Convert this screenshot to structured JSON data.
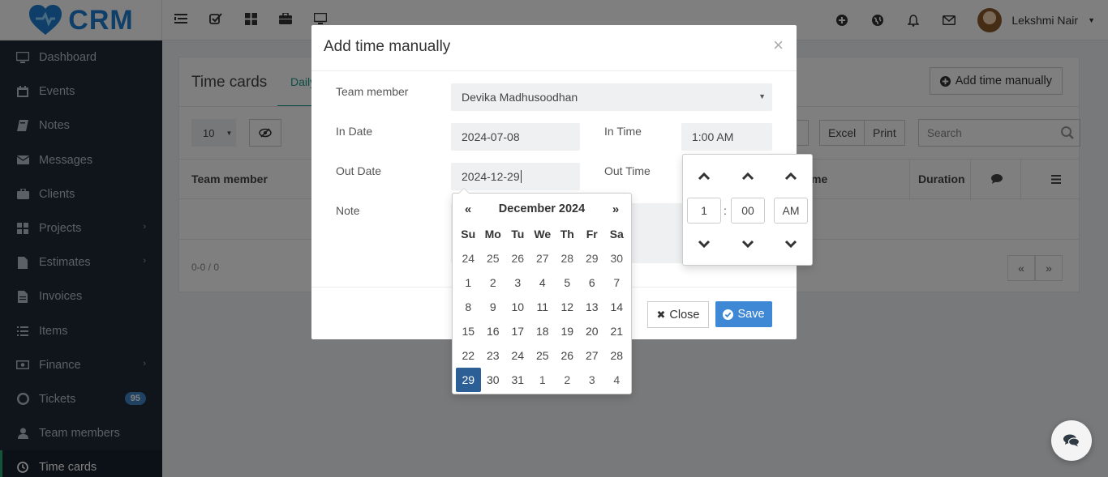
{
  "brand": {
    "name": "CRM",
    "colors": {
      "logo": "#1f7fd3",
      "accent": "#3f88d6",
      "active": "#2aa672"
    }
  },
  "topbar": {
    "left_icons": [
      "list-icon",
      "check-square-icon",
      "grid-icon",
      "briefcase-icon",
      "desktop-icon"
    ],
    "right_icons": [
      "plus-circle-icon",
      "globe-icon",
      "bell-icon",
      "envelope-icon"
    ],
    "user_name": "Lekshmi Nair"
  },
  "sidebar": {
    "items": [
      {
        "label": "Dashboard",
        "icon": "desktop-icon"
      },
      {
        "label": "Events",
        "icon": "calendar-icon"
      },
      {
        "label": "Notes",
        "icon": "book-icon"
      },
      {
        "label": "Messages",
        "icon": "envelope-icon"
      },
      {
        "label": "Clients",
        "icon": "briefcase-icon"
      },
      {
        "label": "Projects",
        "icon": "grid-icon",
        "chevron": "›"
      },
      {
        "label": "Estimates",
        "icon": "file-icon",
        "chevron": "›"
      },
      {
        "label": "Invoices",
        "icon": "file-text-icon"
      },
      {
        "label": "Items",
        "icon": "list-icon"
      },
      {
        "label": "Finance",
        "icon": "money-icon",
        "chevron": "›"
      },
      {
        "label": "Tickets",
        "icon": "life-ring-icon",
        "badge": "95"
      },
      {
        "label": "Team members",
        "icon": "user-icon"
      },
      {
        "label": "Time cards",
        "icon": "clock-icon",
        "active": true
      }
    ]
  },
  "page": {
    "title": "Time cards",
    "tab_daily": "Daily",
    "add_button": "Add time manually",
    "page_size": "10",
    "excel": "Excel",
    "print": "Print",
    "search_placeholder": "Search",
    "columns": {
      "team_member": "Team member",
      "time": "me",
      "duration": "Duration"
    },
    "count": "0-0 / 0",
    "pager": {
      "prev": "«",
      "next": "»"
    }
  },
  "modal": {
    "title": "Add time manually",
    "close_x": "×",
    "labels": {
      "team_member": "Team member",
      "in_date": "In Date",
      "in_time": "In Time",
      "out_date": "Out Date",
      "out_time": "Out Time",
      "note": "Note"
    },
    "values": {
      "team_member": "Devika Madhusoodhan",
      "in_date": "2024-07-08",
      "in_time": "1:00 AM",
      "out_date": "2024-12-29"
    },
    "buttons": {
      "close": "Close",
      "save": "Save"
    }
  },
  "datepicker": {
    "prev": "«",
    "next": "»",
    "month_label": "December 2024",
    "weekdays": [
      "Su",
      "Mo",
      "Tu",
      "We",
      "Th",
      "Fr",
      "Sa"
    ],
    "weeks": [
      [
        "24",
        "25",
        "26",
        "27",
        "28",
        "29",
        "30"
      ],
      [
        "1",
        "2",
        "3",
        "4",
        "5",
        "6",
        "7"
      ],
      [
        "8",
        "9",
        "10",
        "11",
        "12",
        "13",
        "14"
      ],
      [
        "15",
        "16",
        "17",
        "18",
        "19",
        "20",
        "21"
      ],
      [
        "22",
        "23",
        "24",
        "25",
        "26",
        "27",
        "28"
      ],
      [
        "29",
        "30",
        "31",
        "1",
        "2",
        "3",
        "4"
      ]
    ],
    "selected_day": "29"
  },
  "timepicker": {
    "hour": "1",
    "separator": ":",
    "minute": "00",
    "meridian": "AM"
  }
}
